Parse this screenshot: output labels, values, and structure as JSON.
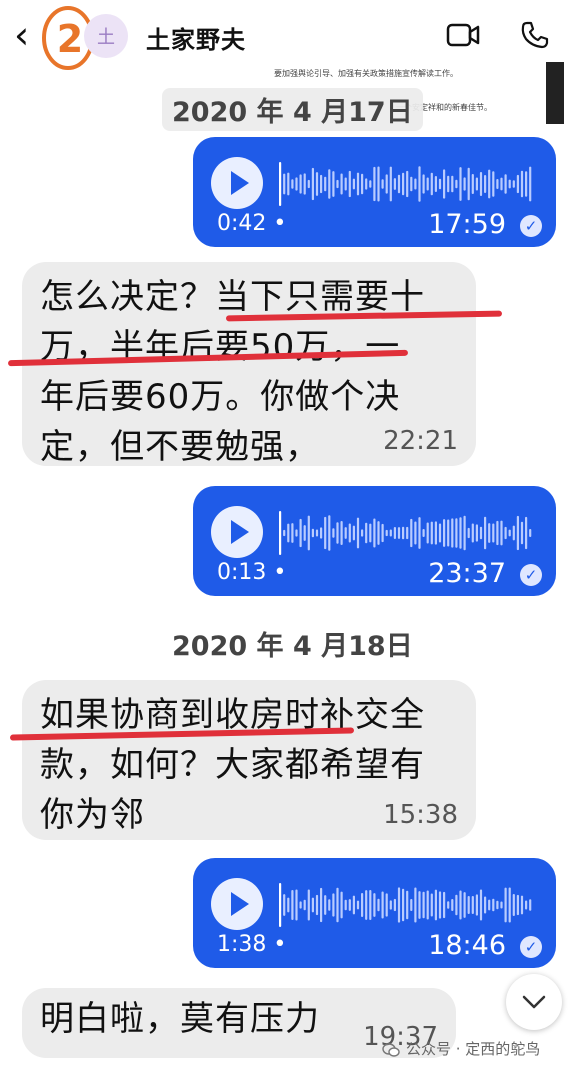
{
  "header": {
    "annotation_number": "2",
    "avatar_text": "土",
    "contact_name": "土家野夫",
    "icons": [
      "back-chevron-icon",
      "video-call-icon",
      "phone-call-icon"
    ]
  },
  "document_fragment": {
    "line1": "要加强舆论引导、加强有关政策措施宣传解读工作。",
    "line2": "一个安定祥和的新春佳节。"
  },
  "messages": [
    {
      "type": "date",
      "text": "2020 年 4 月17日"
    },
    {
      "type": "voice",
      "duration": "0:42 •",
      "time": "17:59"
    },
    {
      "type": "text",
      "lines": [
        "怎么决定？当下只需要十",
        "万，半年后要50万，一",
        "年后要60万。你做个决",
        "定，但不要勉强，"
      ],
      "time": "22:21"
    },
    {
      "type": "voice",
      "duration": "0:13 •",
      "time": "23:37"
    },
    {
      "type": "date",
      "text": "2020 年 4 月18日"
    },
    {
      "type": "text",
      "lines": [
        "如果协商到收房时补交全",
        "款，如何？大家都希望有",
        "你为邻"
      ],
      "time": "15:38"
    },
    {
      "type": "voice",
      "duration": "1:38 •",
      "time": "18:46"
    },
    {
      "type": "text",
      "lines": [
        "明白啦，莫有压力"
      ],
      "time": "19:37"
    }
  ],
  "watermark": "公众号 · 定西的鸵鸟",
  "colors": {
    "voice_bubble": "#1f5be8",
    "text_bubble": "#ececec",
    "underline": "#e0303a",
    "annotation": "#e8752a"
  }
}
